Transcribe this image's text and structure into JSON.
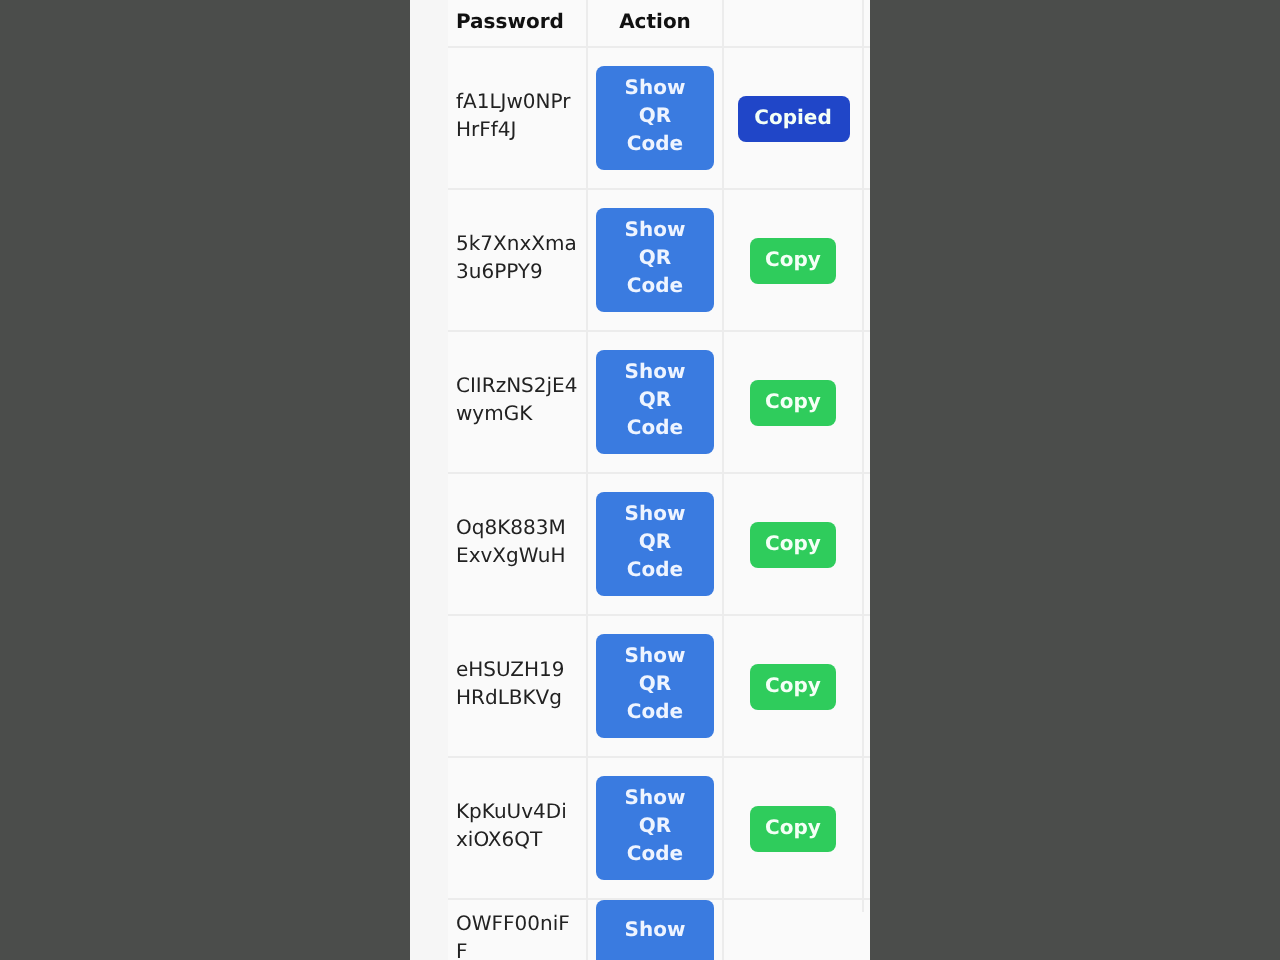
{
  "table": {
    "columns": [
      "Password",
      "Action"
    ],
    "rows": [
      {
        "password": "fA1LJw0NPrHrFf4J",
        "qr_label": "Show QR Code",
        "copy_label": "Copied",
        "copied": true
      },
      {
        "password": "5k7XnxXma3u6PPY9",
        "qr_label": "Show QR Code",
        "copy_label": "Copy",
        "copied": false
      },
      {
        "password": "CIIRzNS2jE4wymGK",
        "qr_label": "Show QR Code",
        "copy_label": "Copy",
        "copied": false
      },
      {
        "password": "Oq8K883MExvXgWuH",
        "qr_label": "Show QR Code",
        "copy_label": "Copy",
        "copied": false
      },
      {
        "password": "eHSUZH19HRdLBKVg",
        "qr_label": "Show QR Code",
        "copy_label": "Copy",
        "copied": false
      },
      {
        "password": "KpKuUv4DixiOX6QT",
        "qr_label": "Show QR Code",
        "copy_label": "Copy",
        "copied": false
      },
      {
        "password": "OWFF00niFF",
        "qr_label": "Show"
      }
    ]
  }
}
